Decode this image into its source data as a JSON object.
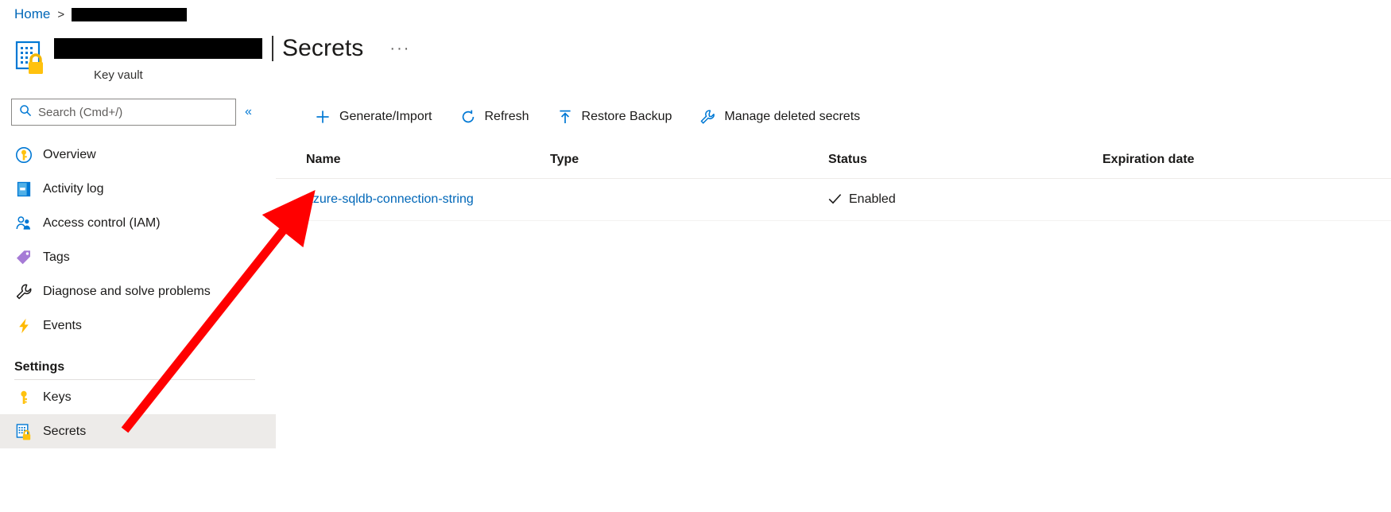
{
  "breadcrumb": {
    "home_label": "Home",
    "separator": ">",
    "redacted_label": ""
  },
  "header": {
    "resource_name_redacted": "",
    "separator": "|",
    "page_title": "Secrets",
    "more_menu": "···",
    "resource_type": "Key vault",
    "icon": "key-vault-icon"
  },
  "sidebar": {
    "search": {
      "placeholder": "Search (Cmd+/)",
      "value": "",
      "icon": "search-icon"
    },
    "collapse_label": "«",
    "items": [
      {
        "label": "Overview",
        "icon": "key-circle-icon",
        "selected": false
      },
      {
        "label": "Activity log",
        "icon": "activity-log-icon",
        "selected": false
      },
      {
        "label": "Access control (IAM)",
        "icon": "people-icon",
        "selected": false
      },
      {
        "label": "Tags",
        "icon": "tag-icon",
        "selected": false
      },
      {
        "label": "Diagnose and solve problems",
        "icon": "wrench-icon",
        "selected": false
      },
      {
        "label": "Events",
        "icon": "lightning-icon",
        "selected": false
      }
    ],
    "settings_section": {
      "title": "Settings",
      "items": [
        {
          "label": "Keys",
          "icon": "key-icon",
          "selected": false
        },
        {
          "label": "Secrets",
          "icon": "secret-icon",
          "selected": true
        }
      ]
    }
  },
  "toolbar": {
    "buttons": [
      {
        "label": "Generate/Import",
        "icon": "plus-icon"
      },
      {
        "label": "Refresh",
        "icon": "refresh-icon"
      },
      {
        "label": "Restore Backup",
        "icon": "upload-arrow-icon"
      },
      {
        "label": "Manage deleted secrets",
        "icon": "wrench-icon"
      }
    ]
  },
  "table": {
    "columns": [
      "Name",
      "Type",
      "Status",
      "Expiration date"
    ],
    "rows": [
      {
        "name": "azure-sqldb-connection-string",
        "type": "",
        "status": "Enabled",
        "status_icon": "checkmark-icon",
        "expiration_date": ""
      }
    ]
  },
  "annotation": {
    "type": "arrow",
    "color": "#FF0000",
    "points_to": "azure-sqldb-connection-string"
  },
  "colors": {
    "link": "#0067b8",
    "accent": "#0078d4",
    "selected_row_bg": "#edebe9",
    "annotation_red": "#FF0000"
  }
}
